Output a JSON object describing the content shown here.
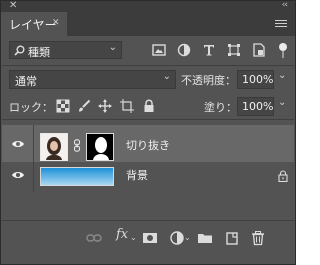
{
  "panel": {
    "tab_label": "レイヤー",
    "close_glyph": "✕",
    "tab_close_glyph": "✕",
    "collapse_glyph": "‹‹"
  },
  "filter": {
    "kind_label": "種類",
    "icons": [
      "image-filter-icon",
      "adjustment-filter-icon",
      "type-filter-icon",
      "shape-filter-icon",
      "smart-object-filter-icon"
    ]
  },
  "blend": {
    "mode": "通常",
    "opacity_label": "不透明度：",
    "opacity_value": "100%",
    "lock_label": "ロック：",
    "fill_label": "塗り：",
    "fill_value": "100%"
  },
  "layers": [
    {
      "name": "切り抜き",
      "selected": true,
      "visible": true,
      "has_mask": true,
      "locked": false
    },
    {
      "name": "背景",
      "selected": false,
      "visible": true,
      "has_mask": false,
      "locked": true
    }
  ],
  "footer_icons": [
    "link-layers-icon",
    "fx-icon",
    "add-mask-icon",
    "adjustment-layer-icon",
    "new-group-icon",
    "new-layer-icon",
    "delete-layer-icon"
  ],
  "footer": {
    "fx_label": "fx"
  },
  "colors": {
    "panel_bg": "#535353",
    "header_bg": "#3c3c3c",
    "selected_row": "#686868",
    "field_bg": "#454545"
  }
}
